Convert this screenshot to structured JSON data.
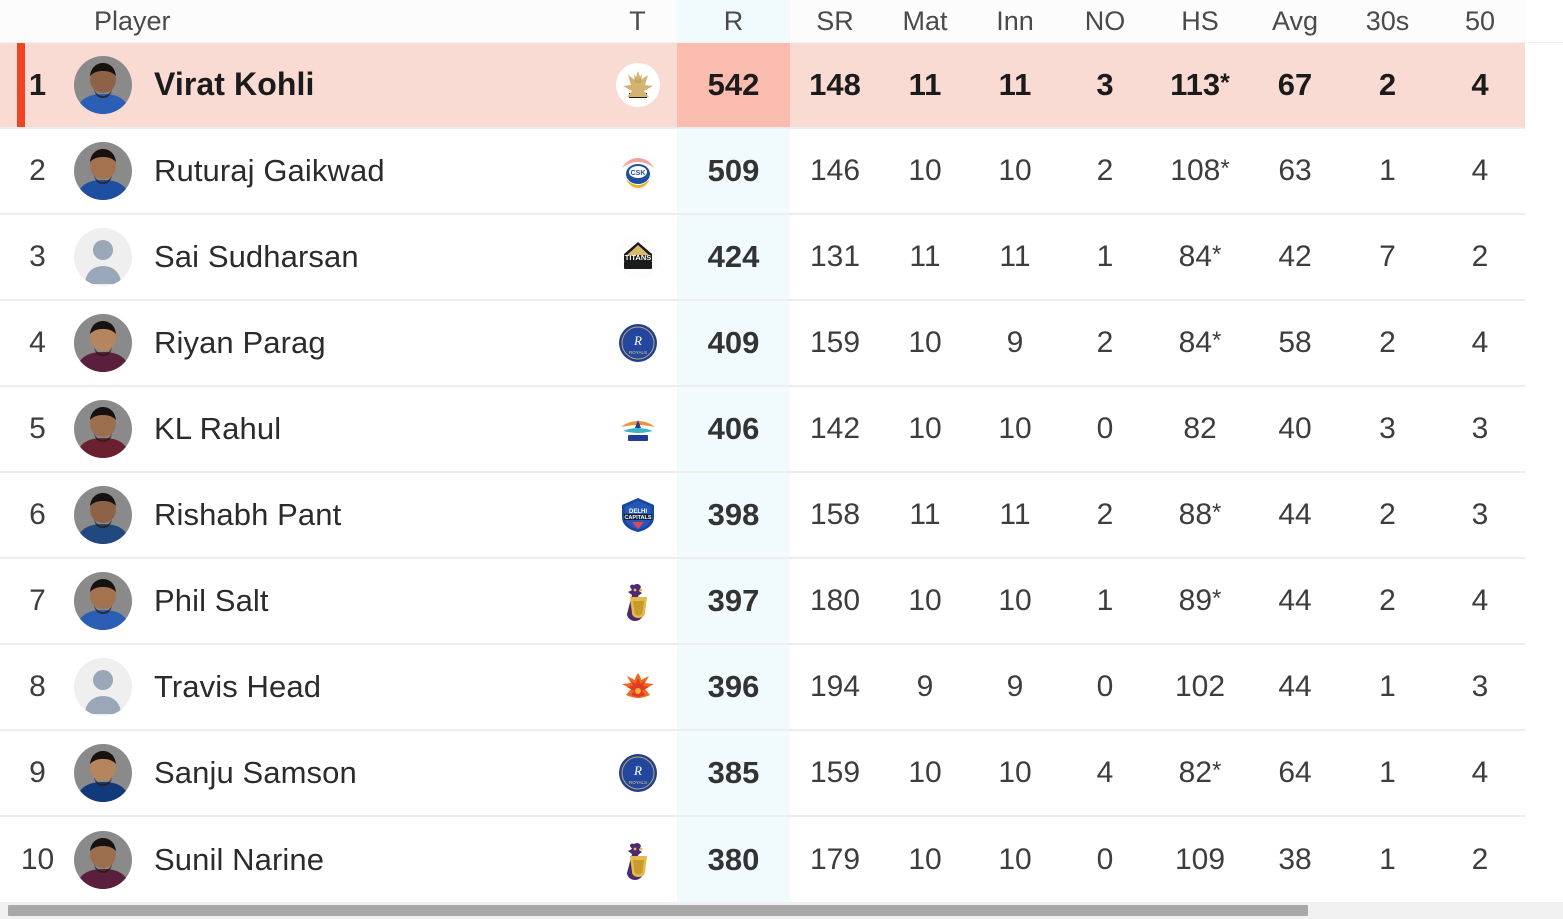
{
  "table": {
    "columns": [
      {
        "key": "rank",
        "label": "",
        "name": "col-rank"
      },
      {
        "key": "name",
        "label": "Player",
        "name": "col-player"
      },
      {
        "key": "team",
        "label": "T",
        "name": "col-team"
      },
      {
        "key": "runs",
        "label": "R",
        "name": "col-runs"
      },
      {
        "key": "sr",
        "label": "SR",
        "name": "col-sr"
      },
      {
        "key": "mat",
        "label": "Mat",
        "name": "col-mat"
      },
      {
        "key": "inn",
        "label": "Inn",
        "name": "col-inn"
      },
      {
        "key": "no",
        "label": "NO",
        "name": "col-no"
      },
      {
        "key": "hs",
        "label": "HS",
        "name": "col-hs"
      },
      {
        "key": "avg",
        "label": "Avg",
        "name": "col-avg"
      },
      {
        "key": "s30",
        "label": "30s",
        "name": "col-30s"
      },
      {
        "key": "s50",
        "label": "50",
        "name": "col-50s"
      }
    ],
    "headers": {
      "player": "Player",
      "team": "T",
      "runs": "R",
      "sr": "SR",
      "mat": "Mat",
      "inn": "Inn",
      "no": "NO",
      "hs": "HS",
      "avg": "Avg",
      "s30": "30s",
      "s50": "50"
    },
    "rows": [
      {
        "rank": "1",
        "name": "Virat Kohli",
        "team": "RCB",
        "avatar": "photo",
        "highlighted": true,
        "runs": "542",
        "sr": "148",
        "mat": "11",
        "inn": "11",
        "no": "3",
        "hs": "113",
        "hs_not_out": true,
        "avg": "67",
        "s30": "2",
        "s50": "4"
      },
      {
        "rank": "2",
        "name": "Ruturaj Gaikwad",
        "team": "CSK",
        "avatar": "photo",
        "highlighted": false,
        "runs": "509",
        "sr": "146",
        "mat": "10",
        "inn": "10",
        "no": "2",
        "hs": "108",
        "hs_not_out": true,
        "avg": "63",
        "s30": "1",
        "s50": "4"
      },
      {
        "rank": "3",
        "name": "Sai Sudharsan",
        "team": "GT",
        "avatar": "placeholder",
        "highlighted": false,
        "runs": "424",
        "sr": "131",
        "mat": "11",
        "inn": "11",
        "no": "1",
        "hs": "84",
        "hs_not_out": true,
        "avg": "42",
        "s30": "7",
        "s50": "2"
      },
      {
        "rank": "4",
        "name": "Riyan Parag",
        "team": "RR",
        "avatar": "photo",
        "highlighted": false,
        "runs": "409",
        "sr": "159",
        "mat": "10",
        "inn": "9",
        "no": "2",
        "hs": "84",
        "hs_not_out": true,
        "avg": "58",
        "s30": "2",
        "s50": "4"
      },
      {
        "rank": "5",
        "name": "KL Rahul",
        "team": "LSG",
        "avatar": "photo",
        "highlighted": false,
        "runs": "406",
        "sr": "142",
        "mat": "10",
        "inn": "10",
        "no": "0",
        "hs": "82",
        "hs_not_out": false,
        "avg": "40",
        "s30": "3",
        "s50": "3"
      },
      {
        "rank": "6",
        "name": "Rishabh Pant",
        "team": "DC",
        "avatar": "photo",
        "highlighted": false,
        "runs": "398",
        "sr": "158",
        "mat": "11",
        "inn": "11",
        "no": "2",
        "hs": "88",
        "hs_not_out": true,
        "avg": "44",
        "s30": "2",
        "s50": "3"
      },
      {
        "rank": "7",
        "name": "Phil Salt",
        "team": "KKR",
        "avatar": "photo",
        "highlighted": false,
        "runs": "397",
        "sr": "180",
        "mat": "10",
        "inn": "10",
        "no": "1",
        "hs": "89",
        "hs_not_out": true,
        "avg": "44",
        "s30": "2",
        "s50": "4"
      },
      {
        "rank": "8",
        "name": "Travis Head",
        "team": "SRH",
        "avatar": "placeholder",
        "highlighted": false,
        "runs": "396",
        "sr": "194",
        "mat": "9",
        "inn": "9",
        "no": "0",
        "hs": "102",
        "hs_not_out": false,
        "avg": "44",
        "s30": "1",
        "s50": "3"
      },
      {
        "rank": "9",
        "name": "Sanju Samson",
        "team": "RR",
        "avatar": "photo",
        "highlighted": false,
        "runs": "385",
        "sr": "159",
        "mat": "10",
        "inn": "10",
        "no": "4",
        "hs": "82",
        "hs_not_out": true,
        "avg": "64",
        "s30": "1",
        "s50": "4"
      },
      {
        "rank": "10",
        "name": "Sunil Narine",
        "team": "KKR",
        "avatar": "photo",
        "highlighted": false,
        "runs": "380",
        "sr": "179",
        "mat": "10",
        "inn": "10",
        "no": "0",
        "hs": "109",
        "hs_not_out": false,
        "avg": "38",
        "s30": "1",
        "s50": "2"
      }
    ]
  },
  "colors": {
    "highlight_row": "#fadbd4",
    "highlight_runs": "#f9bcae",
    "accent_bar": "#f04423",
    "runs_column": "#f1fafc",
    "row_divider": "#ececec",
    "text": "#3d3d3d"
  },
  "scrollbar": {
    "orientation": "horizontal",
    "thumb_color": "#a8a8a8",
    "track_color": "#f0f0f0"
  }
}
